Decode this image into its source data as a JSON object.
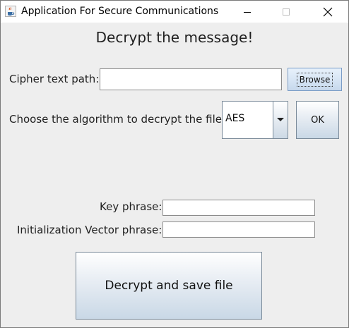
{
  "window": {
    "title": "Application For Secure Communications",
    "icon": "java-cup-icon",
    "controls": [
      "minimize-icon",
      "maximize-icon",
      "close-icon"
    ]
  },
  "heading": "Decrypt the message!",
  "cipher": {
    "label": "Cipher text path:",
    "value": "",
    "browse_label": "Browse"
  },
  "algorithm": {
    "label": "Choose the algorithm to decrypt the file:",
    "selected": "AES",
    "ok_label": "OK"
  },
  "key": {
    "label": "Key phrase:",
    "value": ""
  },
  "iv": {
    "label": "Initialization Vector phrase:",
    "value": ""
  },
  "decrypt_button": "Decrypt and save file"
}
